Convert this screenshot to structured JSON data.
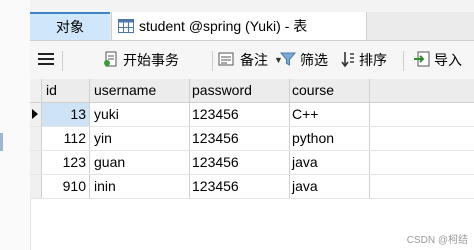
{
  "top_strip": {
    "frag_left": "←",
    "frag_right": "→"
  },
  "tabs": [
    {
      "label": "对象"
    },
    {
      "label": "student @spring (Yuki) - 表"
    }
  ],
  "toolbar": {
    "menu_icon": "hamburger-icon",
    "begin_transaction": "开始事务",
    "note": "备注",
    "filter": "筛选",
    "sort": "排序",
    "import": "导入"
  },
  "table": {
    "columns": [
      "id",
      "username",
      "password",
      "course"
    ],
    "rows": [
      {
        "id": "13",
        "username": "yuki",
        "password": "123456",
        "course": "C++"
      },
      {
        "id": "112",
        "username": "yin",
        "password": "123456",
        "course": "python"
      },
      {
        "id": "123",
        "username": "guan",
        "password": "123456",
        "course": "java"
      },
      {
        "id": "910",
        "username": "inin",
        "password": "123456",
        "course": "java"
      }
    ],
    "selected_row": 0
  },
  "footer": {
    "watermark": "CSDN @柯结"
  },
  "colors": {
    "accent": "#3d84c6",
    "tab_active": "#cfe6fb",
    "selected_cell": "#cfe3f7"
  }
}
